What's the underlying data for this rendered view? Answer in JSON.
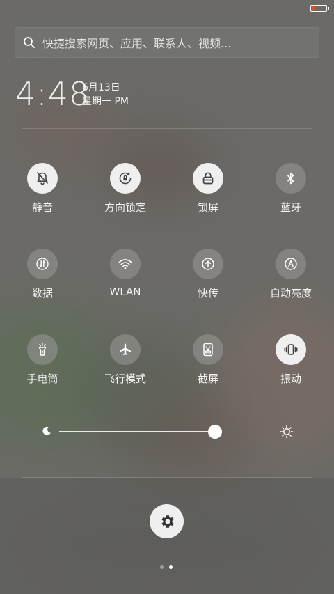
{
  "search": {
    "placeholder": "快捷搜索网页、应用、联系人、视频..."
  },
  "clock": {
    "time": "4:48",
    "date": "6月13日",
    "weekday": "星期一 PM"
  },
  "status": {
    "battery_percent": 20,
    "battery_color": "#e04b3b"
  },
  "toggles": [
    {
      "label": "静音",
      "icon": "bell-off-icon",
      "active": true
    },
    {
      "label": "方向锁定",
      "icon": "rotation-lock-icon",
      "active": true
    },
    {
      "label": "锁屏",
      "icon": "lock-icon",
      "active": true
    },
    {
      "label": "蓝牙",
      "icon": "bluetooth-icon",
      "active": false
    },
    {
      "label": "数据",
      "icon": "mobile-data-icon",
      "active": false
    },
    {
      "label": "WLAN",
      "icon": "wifi-icon",
      "active": false
    },
    {
      "label": "快传",
      "icon": "transfer-icon",
      "active": false
    },
    {
      "label": "自动亮度",
      "icon": "auto-brightness-icon",
      "active": false
    },
    {
      "label": "手电筒",
      "icon": "flashlight-icon",
      "active": false
    },
    {
      "label": "飞行模式",
      "icon": "airplane-icon",
      "active": false
    },
    {
      "label": "截屏",
      "icon": "screenshot-icon",
      "active": false
    },
    {
      "label": "振动",
      "icon": "vibrate-icon",
      "active": true
    }
  ],
  "brightness": {
    "value_percent": 74
  },
  "pager": {
    "pages": 2,
    "current": 2
  }
}
